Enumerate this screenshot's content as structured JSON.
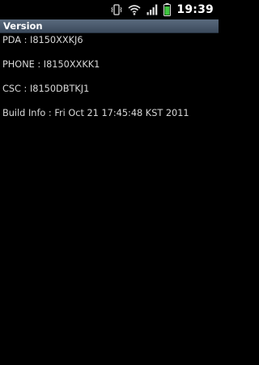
{
  "status_bar": {
    "time": "19:39",
    "icons": [
      "vibrate-icon",
      "wifi-icon",
      "signal-icon",
      "battery-icon"
    ],
    "battery_color": "#3ec43e"
  },
  "title_bar": {
    "title": "Version"
  },
  "info": {
    "pda": "PDA : I8150XXKJ6",
    "phone": "PHONE : I8150XXKK1",
    "csc": "CSC : I8150DBTKJ1",
    "build": "Build Info : Fri Oct 21 17:45:48 KST 2011"
  }
}
